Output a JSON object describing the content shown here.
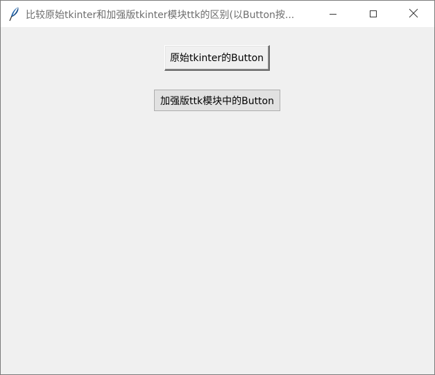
{
  "window": {
    "title": "比较原始tkinter和加强版tkinter模块ttk的区别(以Button按..."
  },
  "buttons": {
    "classic_label": "原始tkinter的Button",
    "ttk_label": "加强版ttk模块中的Button"
  },
  "icons": {
    "app": "feather-icon",
    "minimize": "minimize-icon",
    "maximize": "maximize-icon",
    "close": "close-icon"
  },
  "colors": {
    "client_background": "#f0f0f0",
    "titlebar_background": "#ffffff",
    "title_text": "#6d6d6d",
    "ttk_button_background": "#e1e1e1",
    "ttk_button_border": "#adadad"
  }
}
